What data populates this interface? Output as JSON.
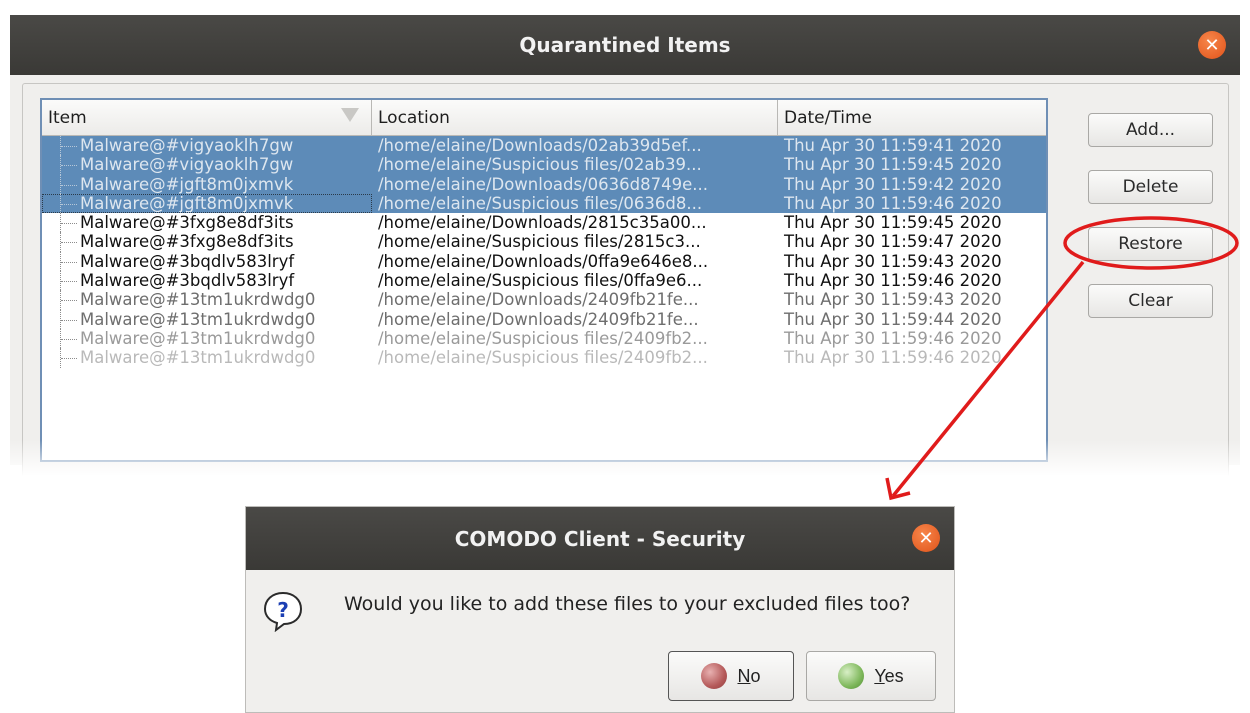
{
  "quarantine_window": {
    "title": "Quarantined Items",
    "close_glyph": "✕",
    "columns": [
      "Item",
      "Location",
      "Date/Time"
    ],
    "rows": [
      {
        "item": "Malware@#vigyaoklh7gw",
        "location": "/home/elaine/Downloads/02ab39d5ef...",
        "datetime": "Thu Apr 30 11:59:41 2020",
        "selected": true
      },
      {
        "item": "Malware@#vigyaoklh7gw",
        "location": "/home/elaine/Suspicious files/02ab39...",
        "datetime": "Thu Apr 30 11:59:45 2020",
        "selected": true
      },
      {
        "item": "Malware@#jgft8m0jxmvk",
        "location": "/home/elaine/Downloads/0636d8749e...",
        "datetime": "Thu Apr 30 11:59:42 2020",
        "selected": true
      },
      {
        "item": "Malware@#jgft8m0jxmvk",
        "location": "/home/elaine/Suspicious files/0636d8...",
        "datetime": "Thu Apr 30 11:59:46 2020",
        "selected": true
      },
      {
        "item": "Malware@#3fxg8e8df3its",
        "location": "/home/elaine/Downloads/2815c35a00...",
        "datetime": "Thu Apr 30 11:59:45 2020",
        "selected": false
      },
      {
        "item": "Malware@#3fxg8e8df3its",
        "location": "/home/elaine/Suspicious files/2815c3...",
        "datetime": "Thu Apr 30 11:59:47 2020",
        "selected": false
      },
      {
        "item": "Malware@#3bqdlv583lryf",
        "location": "/home/elaine/Downloads/0ffa9e646e8...",
        "datetime": "Thu Apr 30 11:59:43 2020",
        "selected": false
      },
      {
        "item": "Malware@#3bqdlv583lryf",
        "location": "/home/elaine/Suspicious files/0ffa9e6...",
        "datetime": "Thu Apr 30 11:59:46 2020",
        "selected": false
      },
      {
        "item": "Malware@#13tm1ukrdwdg0",
        "location": "/home/elaine/Downloads/2409fb21fe...",
        "datetime": "Thu Apr 30 11:59:43 2020",
        "selected": false
      },
      {
        "item": "Malware@#13tm1ukrdwdg0",
        "location": "/home/elaine/Downloads/2409fb21fe...",
        "datetime": "Thu Apr 30 11:59:44 2020",
        "selected": false
      },
      {
        "item": "Malware@#13tm1ukrdwdg0",
        "location": "/home/elaine/Suspicious files/2409fb2...",
        "datetime": "Thu Apr 30 11:59:46 2020",
        "selected": false
      },
      {
        "item": "Malware@#13tm1ukrdwdg0",
        "location": "/home/elaine/Suspicious files/2409fb2...",
        "datetime": "Thu Apr 30 11:59:46 2020",
        "selected": false
      }
    ],
    "buttons": {
      "add": "Add...",
      "delete": "Delete",
      "restore": "Restore",
      "clear": "Clear"
    }
  },
  "annotation": {
    "color": "#e01b1b"
  },
  "dialog": {
    "title": "COMODO Client - Security",
    "close_glyph": "✕",
    "message": "Would you like to add these files to your excluded files too?",
    "icon_glyph": "?",
    "no": {
      "mnemonic": "N",
      "rest": "o"
    },
    "yes": {
      "mnemonic": "Y",
      "rest": "es"
    }
  }
}
